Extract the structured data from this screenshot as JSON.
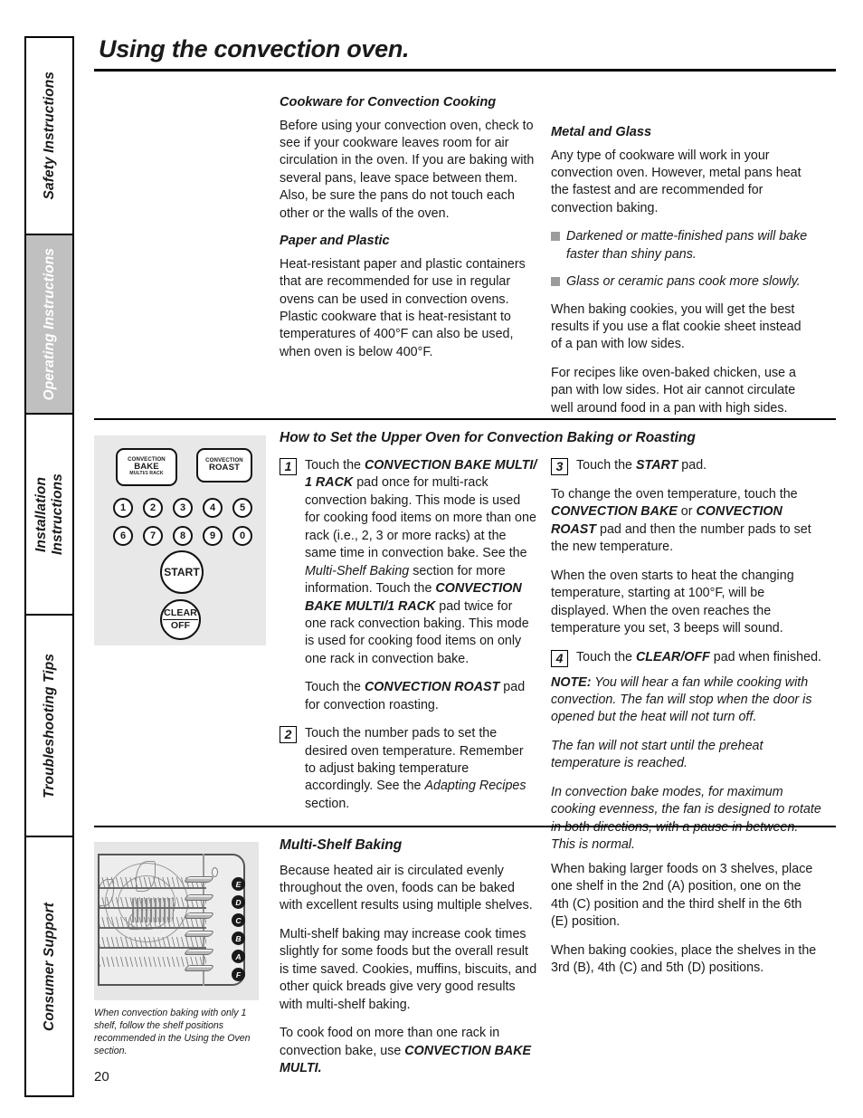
{
  "sidebar": {
    "tabs": [
      {
        "label": "Safety Instructions",
        "active": false
      },
      {
        "label": "Operating Instructions",
        "active": true
      },
      {
        "label": "Installation Instructions",
        "active": false
      },
      {
        "label": "Troubleshooting Tips",
        "active": false
      },
      {
        "label": "Consumer Support",
        "active": false
      }
    ]
  },
  "header": {
    "title": "Using the convection oven."
  },
  "page_number": "20",
  "section_cookware": {
    "heading": "Cookware for Convection Cooking",
    "intro": "Before using your convection oven, check to see if your cookware leaves room for air circulation in the oven. If you are baking with several pans, leave space between them. Also, be sure the pans do not touch each other or the walls of the oven.",
    "paper_heading": "Paper and Plastic",
    "paper_body": "Heat-resistant paper and plastic containers that are recommended for use in regular ovens can be used in convection ovens. Plastic cookware that is heat-resistant to temperatures of 400°F can also be used, when oven is below 400°F.",
    "metal_heading": "Metal and Glass",
    "metal_body": "Any type of cookware will work in your convection oven. However, metal pans heat the fastest and are recommended for convection baking.",
    "bullets": [
      "Darkened or matte-finished pans will bake faster than shiny pans.",
      "Glass or ceramic pans cook more slowly."
    ],
    "cookies_body": "When baking cookies, you will get the best results if you use a flat cookie sheet instead of a pan with low sides.",
    "chicken_body": "For recipes like oven-baked chicken, use a pan with low sides. Hot air cannot circulate well around food in a pan with high sides."
  },
  "control_panel": {
    "convection_bake": {
      "line1": "CONVECTION",
      "line2": "BAKE",
      "line3": "MULTI/1 RACK"
    },
    "convection_roast": {
      "line1": "CONVECTION",
      "line2": "ROAST"
    },
    "number_pads": [
      "1",
      "2",
      "3",
      "4",
      "5",
      "6",
      "7",
      "8",
      "9",
      "0"
    ],
    "start": "START",
    "clear_off": {
      "line1": "CLEAR",
      "line2": "OFF"
    }
  },
  "section_howto": {
    "heading": "How to Set the Upper Oven for Convection Baking or Roasting",
    "steps": [
      {
        "num": "1",
        "parts": [
          {
            "t": "Touch the ",
            "s": "n"
          },
          {
            "t": "CONVECTION BAKE MULTI/ 1 RACK",
            "s": "bi"
          },
          {
            "t": " pad once for multi-rack convection baking. This mode is used for cooking food items on more than one rack (i.e., 2, 3 or more racks) at the same time in convection bake. See the ",
            "s": "n"
          },
          {
            "t": "Multi-Shelf Baking",
            "s": "i"
          },
          {
            "t": " section for more information. Touch the ",
            "s": "n"
          },
          {
            "t": "CONVECTION BAKE MULTI/1 RACK",
            "s": "bi"
          },
          {
            "t": " pad twice for one rack convection baking. This mode is used for cooking food items on only one rack in convection bake.",
            "s": "n"
          }
        ]
      }
    ],
    "roast_note": [
      {
        "t": "Touch the ",
        "s": "n"
      },
      {
        "t": "CONVECTION ROAST",
        "s": "bi"
      },
      {
        "t": " pad for convection roasting.",
        "s": "n"
      }
    ],
    "step2": {
      "num": "2",
      "parts": [
        {
          "t": "Touch the number pads to set the desired oven temperature. Remember to adjust baking temperature accordingly. See the ",
          "s": "n"
        },
        {
          "t": "Adapting Recipes",
          "s": "i"
        },
        {
          "t": " section.",
          "s": "n"
        }
      ]
    },
    "step3": {
      "num": "3",
      "parts": [
        {
          "t": "Touch the ",
          "s": "n"
        },
        {
          "t": "START",
          "s": "bi"
        },
        {
          "t": " pad.",
          "s": "n"
        }
      ]
    },
    "step3_follow": [
      {
        "t": "To change the oven temperature, touch the ",
        "s": "n"
      },
      {
        "t": "CONVECTION BAKE",
        "s": "bi"
      },
      {
        "t": " or ",
        "s": "n"
      },
      {
        "t": "CONVECTION ROAST",
        "s": "bi"
      },
      {
        "t": " pad and then the number pads to set the new temperature.",
        "s": "n"
      }
    ],
    "step3_follow2": "When the oven starts to heat the changing temperature, starting at 100°F, will be displayed. When the oven reaches the temperature you set, 3 beeps will sound.",
    "step4": {
      "num": "4",
      "parts": [
        {
          "t": "Touch the ",
          "s": "n"
        },
        {
          "t": "CLEAR/OFF",
          "s": "bi"
        },
        {
          "t": " pad when finished.",
          "s": "n"
        }
      ]
    },
    "note": [
      {
        "t": "NOTE:",
        "s": "bi"
      },
      {
        "t": " You will hear a fan while cooking with convection. The fan will stop when the door  is opened but the heat will not turn off.",
        "s": "i"
      }
    ],
    "note2": "The fan will not start until the preheat temperature is reached.",
    "note3": "In convection bake modes, for maximum cooking evenness, the fan is designed to rotate in both directions, with a pause in between. This is normal."
  },
  "section_multishelf": {
    "heading": "Multi-Shelf Baking",
    "p1": "Because heated air is circulated evenly throughout the oven, foods can be baked with excellent results using multiple shelves.",
    "p2": "Multi-shelf baking may increase cook times slightly for some foods but the overall result is time saved. Cookies, muffins, biscuits, and other quick breads give very good results with multi-shelf baking.",
    "p3_parts": [
      {
        "t": "To cook food on more than one rack in convection bake, use ",
        "s": "n"
      },
      {
        "t": "CONVECTION BAKE MULTI.",
        "s": "bi"
      }
    ],
    "p4": "When baking larger foods on 3 shelves, place one shelf in the 2nd (A) position, one on the 4th (C) position and the third shelf in the 6th (E) position.",
    "p5": "When baking cookies, place the shelves in the 3rd (B), 4th (C) and 5th (D) positions.",
    "oven_rack_labels": [
      "E",
      "D",
      "C",
      "B",
      "A",
      "F"
    ],
    "caption": "When convection baking with only 1 shelf, follow the shelf positions recommended in the Using the Oven section."
  },
  "colors": {
    "tab_active_bg": "#c0c0c0",
    "panel_bg": "#e8e8e8",
    "bullet": "#9b9b9b"
  }
}
